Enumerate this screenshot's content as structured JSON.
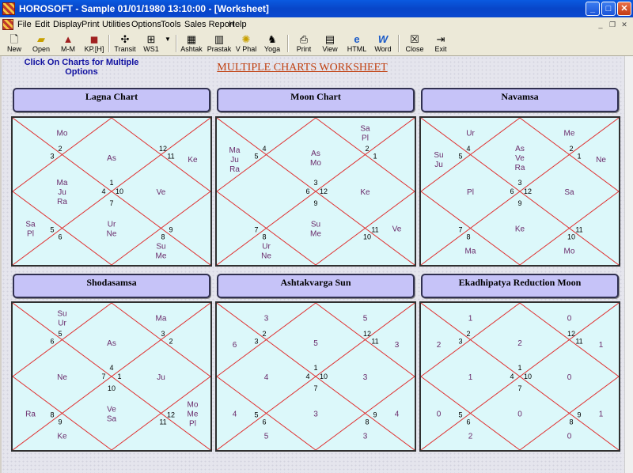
{
  "window": {
    "title": "HOROSOFT -  Sample 01/01/1980 13:10:00 - [Worksheet]"
  },
  "menu": [
    "File",
    "Edit",
    "Display",
    "Print",
    "Utilities",
    "Options",
    "Tools",
    "Sales Report",
    "Help"
  ],
  "toolbar": [
    {
      "label": "New",
      "icon": "new-file-icon"
    },
    {
      "label": "Open",
      "icon": "open-icon"
    },
    {
      "label": "M-M",
      "icon": "mm-icon"
    },
    {
      "label": "KP.[H]",
      "icon": "kp-icon"
    },
    {
      "label": "Transit",
      "icon": "transit-icon"
    },
    {
      "label": "WS1",
      "icon": "ws1-icon"
    },
    {
      "label": "Ashtak",
      "icon": "ashtak-icon"
    },
    {
      "label": "Prastak",
      "icon": "prastak-icon"
    },
    {
      "label": "V Phal",
      "icon": "vphal-icon"
    },
    {
      "label": "Yoga",
      "icon": "yoga-icon"
    },
    {
      "label": "Print",
      "icon": "print-icon"
    },
    {
      "label": "View",
      "icon": "view-icon"
    },
    {
      "label": "HTML",
      "icon": "html-icon"
    },
    {
      "label": "Word",
      "icon": "word-icon"
    },
    {
      "label": "Close",
      "icon": "close-icon"
    },
    {
      "label": "Exit",
      "icon": "exit-icon"
    }
  ],
  "hint": "Click On Charts for Multiple Options",
  "worksheet_title": "MULTIPLE CHARTS WORKSHEET",
  "charts": [
    {
      "title": "Lagna Chart",
      "houses": [
        [
          "As"
        ],
        [
          "Mo"
        ],
        [],
        [
          "Ma",
          "Ju",
          "Ra"
        ],
        [
          "Sa",
          "Pl"
        ],
        [],
        [
          "Ur",
          "Ne"
        ],
        [
          "Su",
          "Me"
        ],
        [],
        [
          "Ve"
        ],
        [
          "Ke"
        ],
        []
      ],
      "signs": [
        "1",
        "2",
        "3",
        "4",
        "5",
        "6",
        "7",
        "8",
        "9",
        "10",
        "11",
        "12"
      ]
    },
    {
      "title": "Moon Chart",
      "houses": [
        [
          "As",
          "Mo"
        ],
        [],
        [
          "Ma",
          "Ju",
          "Ra"
        ],
        [],
        [],
        [
          "Ur",
          "Ne"
        ],
        [
          "Su",
          "Me"
        ],
        [],
        [
          "Ve"
        ],
        [
          "Ke"
        ],
        [],
        [
          "Sa",
          "Pl"
        ]
      ],
      "signs": [
        "3",
        "4",
        "5",
        "6",
        "7",
        "8",
        "9",
        "10",
        "11",
        "12",
        "1",
        "2"
      ]
    },
    {
      "title": "Navamsa",
      "houses": [
        [
          "As",
          "Ve",
          "Ra"
        ],
        [
          "Ur"
        ],
        [
          "Su",
          "Ju"
        ],
        [
          "Pl"
        ],
        [],
        [
          "Ma"
        ],
        [
          "Ke"
        ],
        [
          "Mo"
        ],
        [],
        [
          "Sa"
        ],
        [
          "Ne"
        ],
        [
          "Me"
        ]
      ],
      "signs": [
        "3",
        "4",
        "5",
        "6",
        "7",
        "8",
        "9",
        "10",
        "11",
        "12",
        "1",
        "2"
      ]
    },
    {
      "title": "Shodasamsa",
      "houses": [
        [
          "As"
        ],
        [
          "Su",
          "Ur"
        ],
        [],
        [
          "Ne"
        ],
        [
          "Ra"
        ],
        [
          "Ke"
        ],
        [
          "Ve",
          "Sa"
        ],
        [],
        [
          "Mo",
          "Me",
          "Pl"
        ],
        [
          "Ju"
        ],
        [],
        [
          "Ma"
        ]
      ],
      "signs": [
        "4",
        "5",
        "6",
        "7",
        "8",
        "9",
        "10",
        "11",
        "12",
        "1",
        "2",
        "3"
      ]
    },
    {
      "title": "Ashtakvarga Sun",
      "houses": [
        [
          "5"
        ],
        [
          "3"
        ],
        [
          "6"
        ],
        [
          "4"
        ],
        [
          "4"
        ],
        [
          "5"
        ],
        [
          "3"
        ],
        [
          "3"
        ],
        [
          "4"
        ],
        [
          "3"
        ],
        [
          "3"
        ],
        [
          "5"
        ]
      ],
      "signs": [
        "1",
        "2",
        "3",
        "4",
        "5",
        "6",
        "7",
        "8",
        "9",
        "10",
        "11",
        "12"
      ]
    },
    {
      "title": "Ekadhipatya Reduction Moon",
      "houses": [
        [
          "2"
        ],
        [
          "1"
        ],
        [
          "2"
        ],
        [
          "1"
        ],
        [
          "0"
        ],
        [
          "2"
        ],
        [
          "0"
        ],
        [
          "0"
        ],
        [
          "1"
        ],
        [
          "0"
        ],
        [
          "1"
        ],
        [
          "0"
        ]
      ],
      "signs": [
        "1",
        "2",
        "3",
        "4",
        "5",
        "6",
        "7",
        "8",
        "9",
        "10",
        "11",
        "12"
      ]
    }
  ],
  "colors": {
    "chart_bg": "#dcf8fa",
    "chart_lines": "#e03030",
    "planet_text": "#6a2a6a",
    "title_bg": "#c6c3f8"
  }
}
